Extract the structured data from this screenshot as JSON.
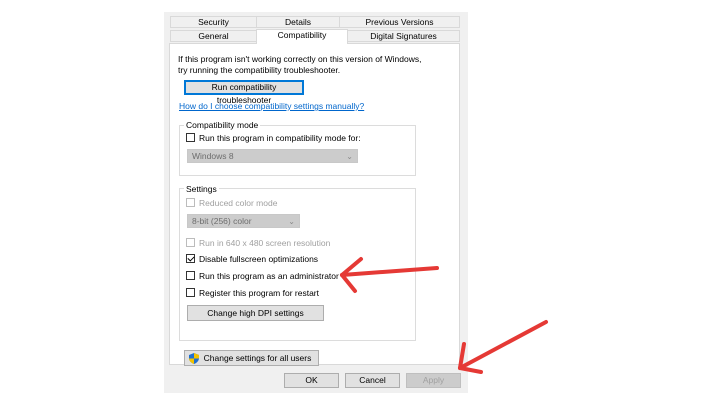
{
  "tabs": {
    "security": "Security",
    "details": "Details",
    "previous_versions": "Previous Versions",
    "general": "General",
    "compatibility": "Compatibility",
    "digital_signatures": "Digital Signatures"
  },
  "intro": {
    "line1": "If this program isn't working correctly on this version of Windows,",
    "line2": "try running the compatibility troubleshooter."
  },
  "troubleshooter_button": "Run compatibility troubleshooter",
  "manual_link": "How do I choose compatibility settings manually?",
  "compat_mode": {
    "legend": "Compatibility mode",
    "checkbox_label": "Run this program in compatibility mode for:",
    "checked": false,
    "select_value": "Windows 8"
  },
  "settings": {
    "legend": "Settings",
    "reduced_color": {
      "label": "Reduced color mode",
      "checked": false,
      "enabled": false
    },
    "color_select": "8-bit (256) color",
    "res_640": {
      "label": "Run in 640 x 480 screen resolution",
      "checked": false,
      "enabled": false
    },
    "disable_fullscreen": {
      "label": "Disable fullscreen optimizations",
      "checked": true,
      "enabled": true
    },
    "run_admin": {
      "label": "Run this program as an administrator",
      "checked": false,
      "enabled": true
    },
    "register_restart": {
      "label": "Register this program for restart",
      "checked": false,
      "enabled": true
    },
    "dpi_button": "Change high DPI settings"
  },
  "all_users_button": "Change settings for all users",
  "footer": {
    "ok": "OK",
    "cancel": "Cancel",
    "apply": "Apply"
  },
  "colors": {
    "annotation_arrow": "#e53935",
    "link": "#0066cc",
    "focus": "#0078d7"
  },
  "icons": {
    "shield": "uac-shield-icon"
  }
}
